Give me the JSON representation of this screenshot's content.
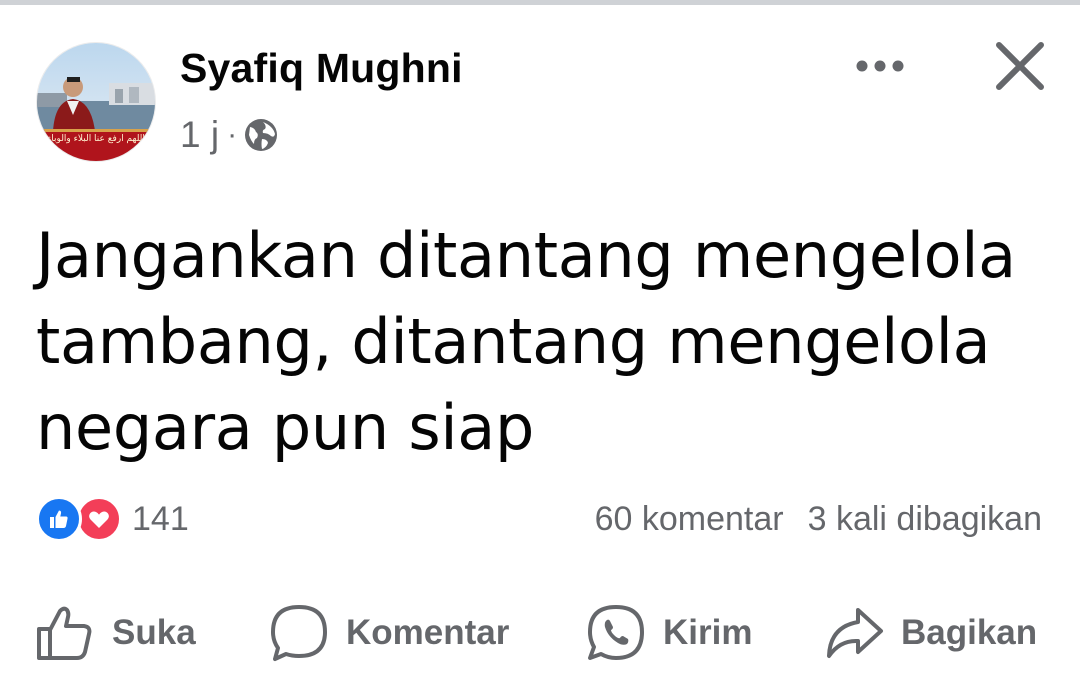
{
  "post": {
    "author": "Syafiq Mughni",
    "time": "1 j",
    "separator": "·",
    "audience_icon": "globe-icon",
    "text": "Jangankan ditantang mengelola tambang, ditantang mengelola negara pun siap",
    "avatar_caption": "اللهم ارفع عنا البلاء والوباء"
  },
  "reactions": {
    "icons": [
      "like-icon",
      "love-icon"
    ],
    "count": "141",
    "comments": "60 komentar",
    "shares": "3 kali dibagikan"
  },
  "actions": {
    "like": "Suka",
    "comment": "Komentar",
    "send": "Kirim",
    "share": "Bagikan"
  },
  "colors": {
    "text": "#050505",
    "secondary": "#65676b",
    "like_blue": "#1877f2",
    "love_red": "#f33e58"
  }
}
